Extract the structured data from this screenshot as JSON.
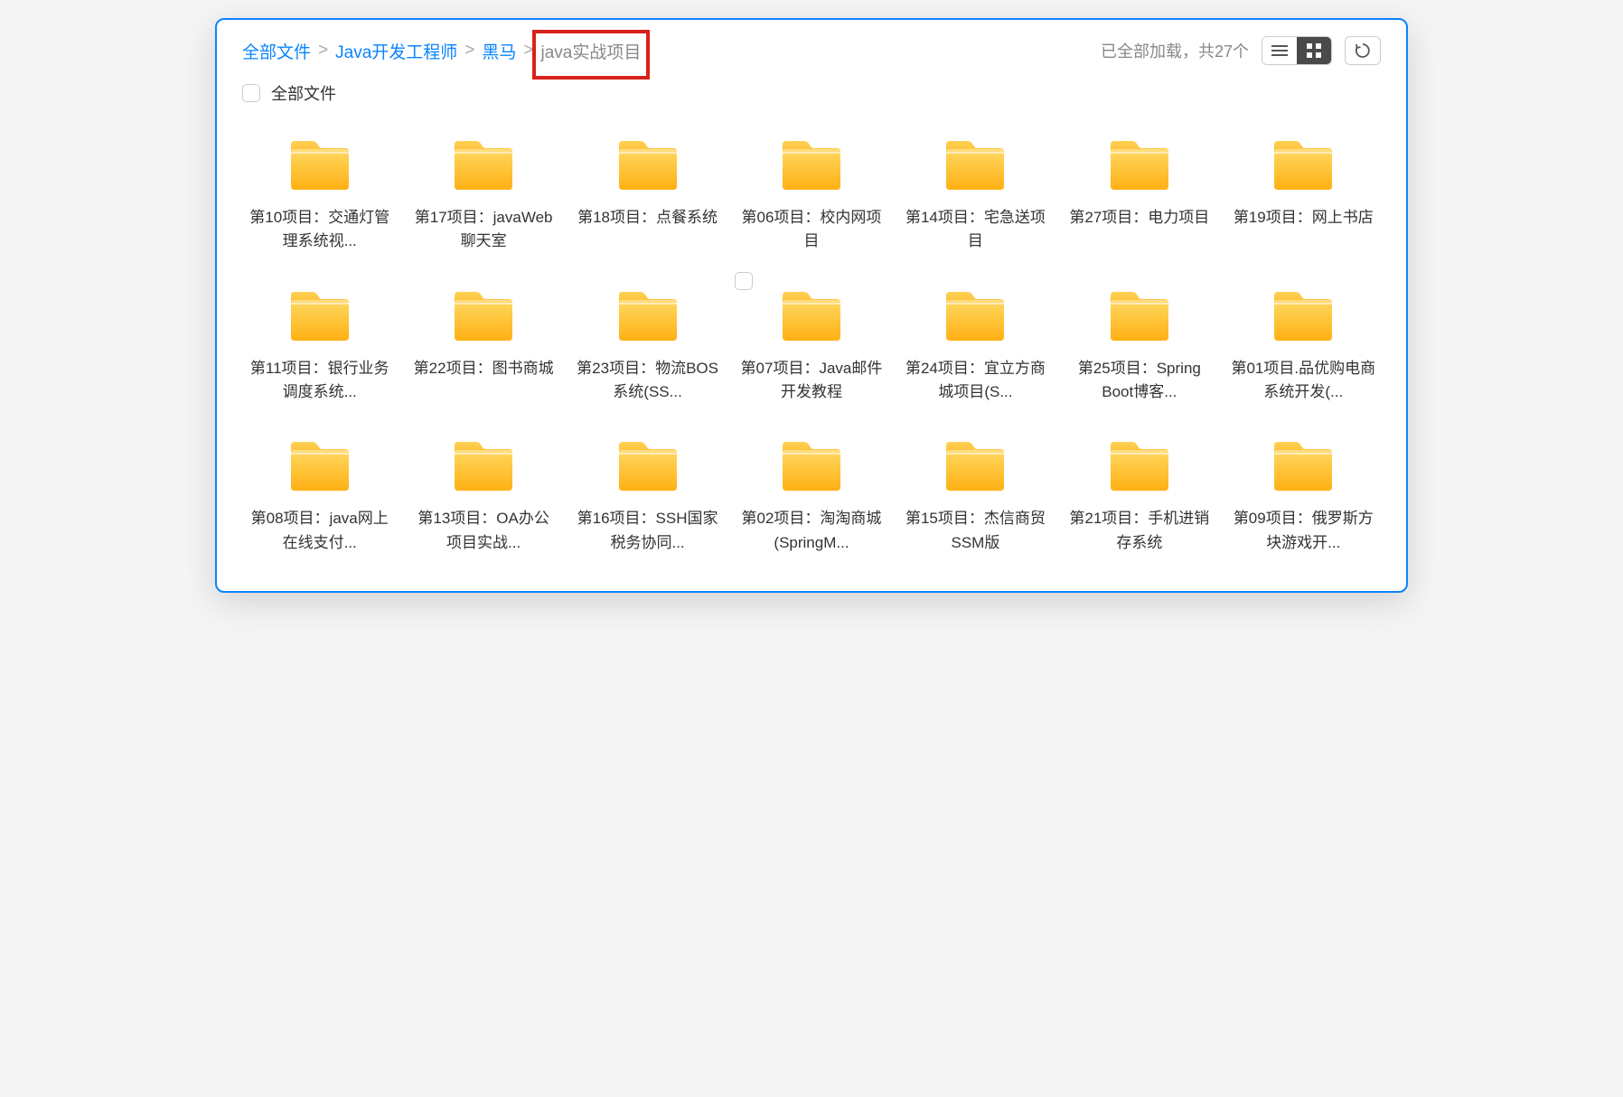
{
  "breadcrumb": {
    "items": [
      {
        "label": "全部文件"
      },
      {
        "label": "Java开发工程师"
      },
      {
        "label": "黑马"
      }
    ],
    "current": "java实战项目",
    "separator": ">"
  },
  "header": {
    "status": "已全部加载，共27个"
  },
  "selectAll": {
    "label": "全部文件"
  },
  "folders": [
    {
      "name": "第10项目：交通灯管理系统视..."
    },
    {
      "name": "第17项目：javaWeb聊天室"
    },
    {
      "name": "第18项目：点餐系统"
    },
    {
      "name": "第06项目：校内网项目"
    },
    {
      "name": "第14项目：宅急送项目"
    },
    {
      "name": "第27项目：电力项目"
    },
    {
      "name": "第19项目：网上书店"
    },
    {
      "name": "第11项目：银行业务调度系统..."
    },
    {
      "name": "第22项目：图书商城"
    },
    {
      "name": "第23项目：物流BOS系统(SS..."
    },
    {
      "name": "第07项目：Java邮件开发教程",
      "showCheck": true
    },
    {
      "name": "第24项目：宜立方商城项目(S..."
    },
    {
      "name": "第25项目：Spring Boot博客..."
    },
    {
      "name": "第01项目.品优购电商系统开发(..."
    },
    {
      "name": "第08项目：java网上在线支付..."
    },
    {
      "name": "第13项目：OA办公项目实战..."
    },
    {
      "name": "第16项目：SSH国家税务协同..."
    },
    {
      "name": "第02项目：淘淘商城(SpringM..."
    },
    {
      "name": "第15项目：杰信商贸SSM版"
    },
    {
      "name": "第21项目：手机进销存系统"
    },
    {
      "name": "第09项目：俄罗斯方块游戏开..."
    }
  ]
}
